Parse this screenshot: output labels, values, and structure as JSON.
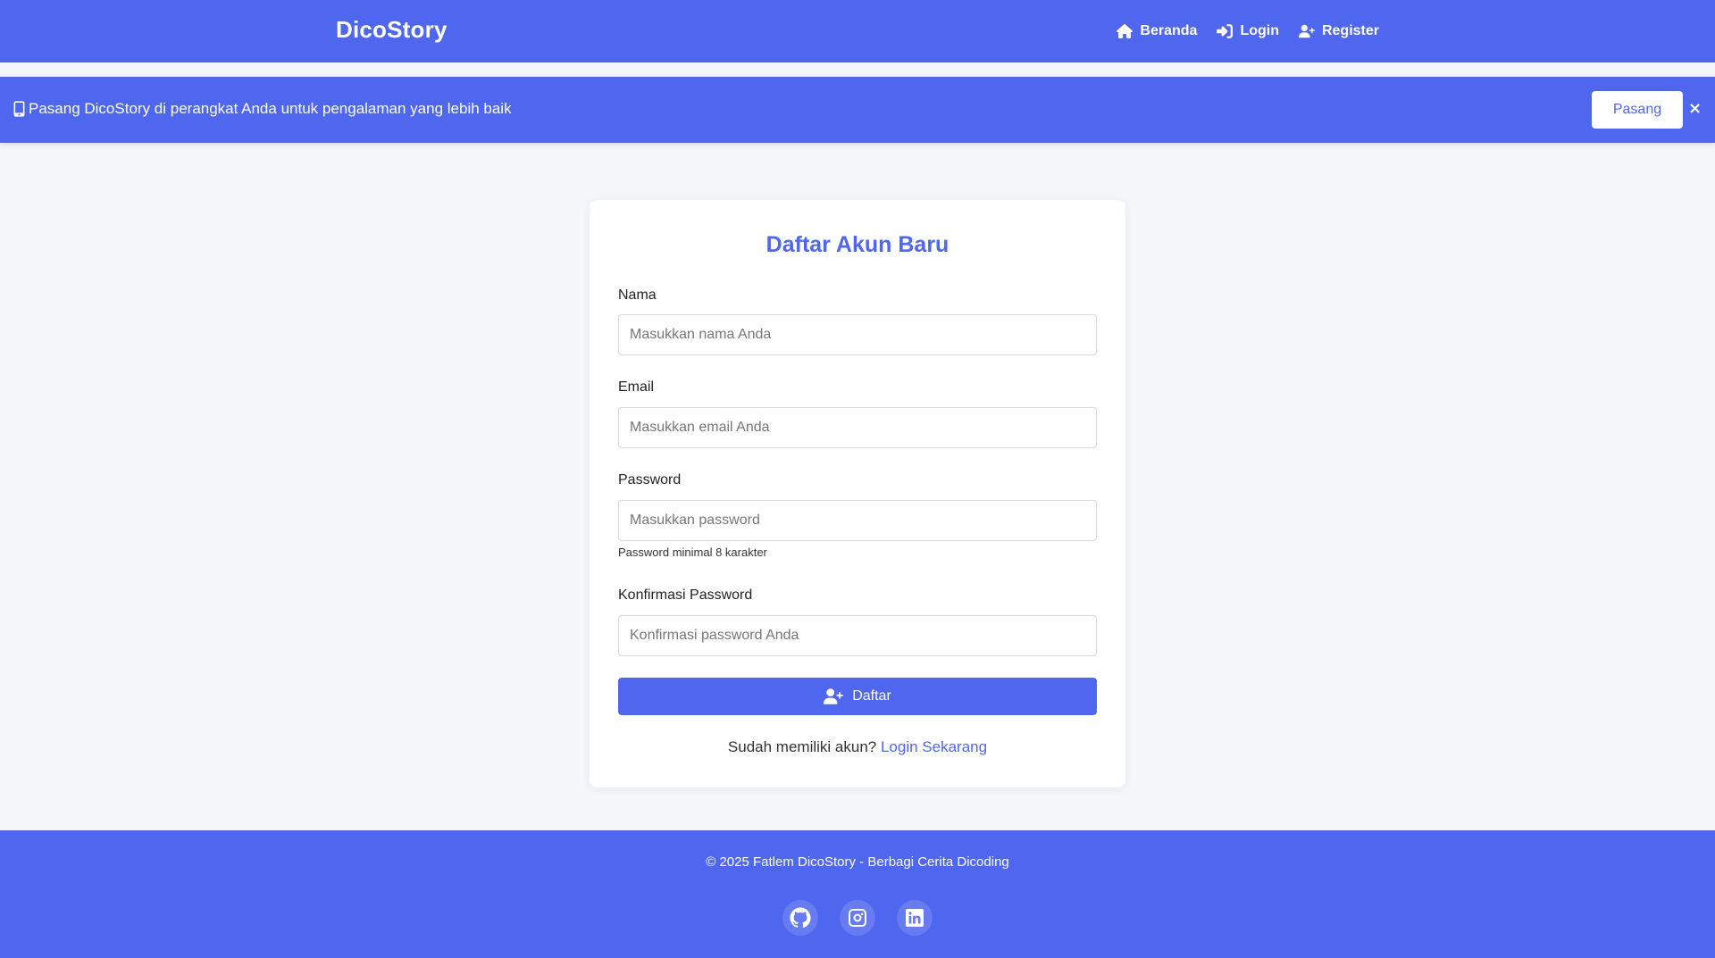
{
  "header": {
    "brand": "DicoStory",
    "nav": [
      {
        "label": "Beranda",
        "icon": "home-icon"
      },
      {
        "label": "Login",
        "icon": "sign-in-icon"
      },
      {
        "label": "Register",
        "icon": "user-plus-icon"
      }
    ]
  },
  "install_banner": {
    "icon": "mobile-icon",
    "text": "Pasang DicoStory di perangkat Anda untuk pengalaman yang lebih baik",
    "button_label": "Pasang",
    "close_label": "×"
  },
  "register_form": {
    "title": "Daftar Akun Baru",
    "fields": {
      "name": {
        "label": "Nama",
        "placeholder": "Masukkan nama Anda",
        "value": ""
      },
      "email": {
        "label": "Email",
        "placeholder": "Masukkan email Anda",
        "value": ""
      },
      "password": {
        "label": "Password",
        "placeholder": "Masukkan password",
        "value": "",
        "hint": "Password minimal 8 karakter"
      },
      "confirm_password": {
        "label": "Konfirmasi Password",
        "placeholder": "Konfirmasi password Anda",
        "value": ""
      }
    },
    "submit_label": "Daftar",
    "login_prompt": "Sudah memiliki akun?",
    "login_link": "Login Sekarang"
  },
  "footer": {
    "copyright": "© 2025 Fatlem DicoStory - Berbagi Cerita Dicoding",
    "social": [
      "github-icon",
      "instagram-icon",
      "linkedin-icon"
    ]
  },
  "colors": {
    "primary": "#4f67ee",
    "background": "#f5f6fa",
    "card": "#ffffff"
  }
}
